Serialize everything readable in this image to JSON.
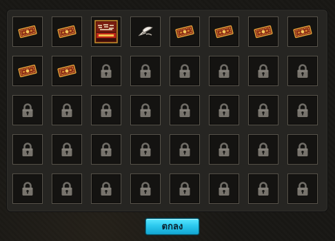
{
  "inventory": {
    "columns": 8,
    "rows": 5,
    "slots": [
      {
        "icon": "ticket-icon"
      },
      {
        "icon": "ticket-icon"
      },
      {
        "icon": "game-box-icon"
      },
      {
        "icon": "feather-quill-icon"
      },
      {
        "icon": "ticket-icon"
      },
      {
        "icon": "ticket-icon"
      },
      {
        "icon": "ticket-icon"
      },
      {
        "icon": "ticket-icon"
      },
      {
        "icon": "ticket-icon"
      },
      {
        "icon": "ticket-icon"
      },
      {
        "icon": "lock-icon"
      },
      {
        "icon": "lock-icon"
      },
      {
        "icon": "lock-icon"
      },
      {
        "icon": "lock-icon"
      },
      {
        "icon": "lock-icon"
      },
      {
        "icon": "lock-icon"
      },
      {
        "icon": "lock-icon"
      },
      {
        "icon": "lock-icon"
      },
      {
        "icon": "lock-icon"
      },
      {
        "icon": "lock-icon"
      },
      {
        "icon": "lock-icon"
      },
      {
        "icon": "lock-icon"
      },
      {
        "icon": "lock-icon"
      },
      {
        "icon": "lock-icon"
      },
      {
        "icon": "lock-icon"
      },
      {
        "icon": "lock-icon"
      },
      {
        "icon": "lock-icon"
      },
      {
        "icon": "lock-icon"
      },
      {
        "icon": "lock-icon"
      },
      {
        "icon": "lock-icon"
      },
      {
        "icon": "lock-icon"
      },
      {
        "icon": "lock-icon"
      },
      {
        "icon": "lock-icon"
      },
      {
        "icon": "lock-icon"
      },
      {
        "icon": "lock-icon"
      },
      {
        "icon": "lock-icon"
      },
      {
        "icon": "lock-icon"
      },
      {
        "icon": "lock-icon"
      },
      {
        "icon": "lock-icon"
      },
      {
        "icon": "lock-icon"
      }
    ]
  },
  "footer": {
    "confirm_label": "ตกลง"
  },
  "colors": {
    "button": "#2cc9ee",
    "slot_border": "#57534a",
    "panel": "#262522"
  }
}
